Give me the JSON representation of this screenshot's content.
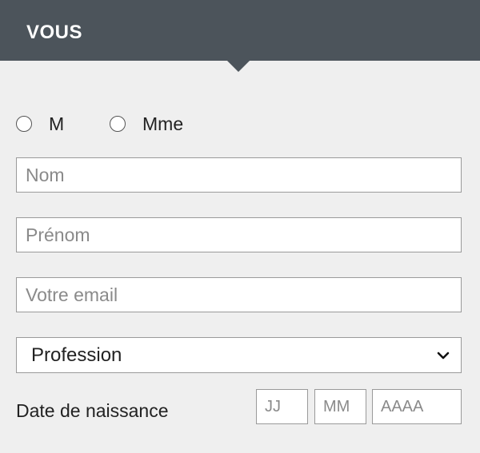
{
  "header": {
    "title": "VOUS"
  },
  "civility": {
    "options": [
      {
        "label": "M"
      },
      {
        "label": "Mme"
      }
    ]
  },
  "fields": {
    "nom_placeholder": "Nom",
    "prenom_placeholder": "Prénom",
    "email_placeholder": "Votre email"
  },
  "profession": {
    "selected": "Profession",
    "icon": "chevron-down-icon"
  },
  "birthdate": {
    "label": "Date de naissance",
    "day_placeholder": "JJ",
    "month_placeholder": "MM",
    "year_placeholder": "AAAA"
  },
  "colors": {
    "header_bg": "#4c545b",
    "page_bg": "#efefef",
    "input_border": "#9a9a9a"
  }
}
